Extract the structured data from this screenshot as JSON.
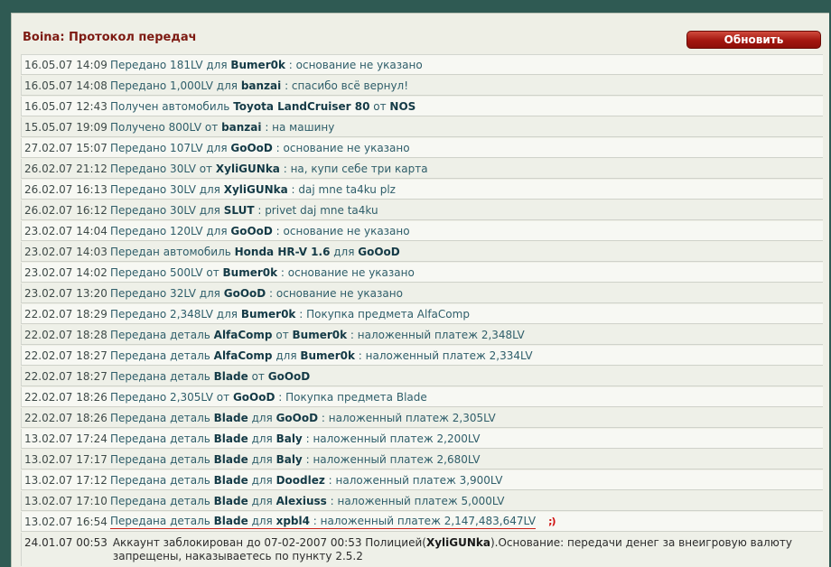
{
  "panel": {
    "title": "Boina: Протокол передач",
    "refresh_label": "Обновить"
  },
  "rows": [
    {
      "ts": "16.05.07 14:09",
      "pre": "Передано 181LV для ",
      "b1": "Bumer0k",
      "mid": " : основание не указано",
      "b2": "",
      "post": ""
    },
    {
      "ts": "16.05.07 14:08",
      "pre": "Передано 1,000LV для ",
      "b1": "banzai",
      "mid": " : спасибо всё вернул!",
      "b2": "",
      "post": ""
    },
    {
      "ts": "16.05.07 12:43",
      "pre": "Получен автомобиль ",
      "b1": "Toyota LandCruiser 80",
      "mid": " от ",
      "b2": "NOS",
      "post": ""
    },
    {
      "ts": "15.05.07 19:09",
      "pre": "Получено 800LV от ",
      "b1": "banzai",
      "mid": " : на машину",
      "b2": "",
      "post": ""
    },
    {
      "ts": "27.02.07 15:07",
      "pre": "Передано 107LV для ",
      "b1": "GoOoD",
      "mid": " : основание не указано",
      "b2": "",
      "post": ""
    },
    {
      "ts": "26.02.07 21:12",
      "pre": "Передано 30LV от ",
      "b1": "XyliGUNka",
      "mid": " : на, купи себе три карта",
      "b2": "",
      "post": ""
    },
    {
      "ts": "26.02.07 16:13",
      "pre": "Передано 30LV для ",
      "b1": "XyliGUNka",
      "mid": " : daj mne ta4ku plz",
      "b2": "",
      "post": ""
    },
    {
      "ts": "26.02.07 16:12",
      "pre": "Передано 30LV для ",
      "b1": "SLUT",
      "mid": " : privet daj mne ta4ku",
      "b2": "",
      "post": ""
    },
    {
      "ts": "23.02.07 14:04",
      "pre": "Передано 120LV для ",
      "b1": "GoOoD",
      "mid": " : основание не указано",
      "b2": "",
      "post": ""
    },
    {
      "ts": "23.02.07 14:03",
      "pre": "Передан автомобиль ",
      "b1": "Honda HR-V 1.6",
      "mid": " для ",
      "b2": "GoOoD",
      "post": ""
    },
    {
      "ts": "23.02.07 14:02",
      "pre": "Передано 500LV от ",
      "b1": "Bumer0k",
      "mid": " : основание не указано",
      "b2": "",
      "post": ""
    },
    {
      "ts": "23.02.07 13:20",
      "pre": "Передано 32LV для ",
      "b1": "GoOoD",
      "mid": " : основание не указано",
      "b2": "",
      "post": ""
    },
    {
      "ts": "22.02.07 18:29",
      "pre": "Передано 2,348LV для ",
      "b1": "Bumer0k",
      "mid": " : Покупка предмета AlfaComp",
      "b2": "",
      "post": ""
    },
    {
      "ts": "22.02.07 18:28",
      "pre": "Передана деталь ",
      "b1": "AlfaComp",
      "mid": " от ",
      "b2": "Bumer0k",
      "post": " : наложенный платеж 2,348LV"
    },
    {
      "ts": "22.02.07 18:27",
      "pre": "Передана деталь ",
      "b1": "AlfaComp",
      "mid": " для ",
      "b2": "Bumer0k",
      "post": " : наложенный платеж 2,334LV"
    },
    {
      "ts": "22.02.07 18:27",
      "pre": "Передана деталь ",
      "b1": "Blade",
      "mid": " от ",
      "b2": "GoOoD",
      "post": ""
    },
    {
      "ts": "22.02.07 18:26",
      "pre": "Передано 2,305LV от ",
      "b1": "GoOoD",
      "mid": " : Покупка предмета Blade",
      "b2": "",
      "post": ""
    },
    {
      "ts": "22.02.07 18:26",
      "pre": "Передана деталь ",
      "b1": "Blade",
      "mid": " для ",
      "b2": "GoOoD",
      "post": " : наложенный платеж 2,305LV"
    },
    {
      "ts": "13.02.07 17:24",
      "pre": "Передана деталь ",
      "b1": "Blade",
      "mid": " для ",
      "b2": "Baly",
      "post": " : наложенный платеж 2,200LV"
    },
    {
      "ts": "13.02.07 17:17",
      "pre": "Передана деталь ",
      "b1": "Blade",
      "mid": " для ",
      "b2": "Baly",
      "post": " : наложенный платеж 2,680LV"
    },
    {
      "ts": "13.02.07 17:12",
      "pre": "Передана деталь ",
      "b1": "Blade",
      "mid": " для ",
      "b2": "Doodlez",
      "post": " : наложенный платеж 3,900LV"
    },
    {
      "ts": "13.02.07 17:10",
      "pre": "Передана деталь ",
      "b1": "Blade",
      "mid": " для ",
      "b2": "Alexiuss",
      "post": " : наложенный платеж 5,000LV"
    },
    {
      "ts": "13.02.07 16:54",
      "pre": "Передана деталь ",
      "b1": "Blade",
      "mid": " для ",
      "b2": "xpbl4",
      "post": " : наложенный платеж 2,147,483,647LV"
    }
  ],
  "wink": ";)",
  "last": {
    "ts": "24.01.07 00:53",
    "pre": "Аккаунт заблокирован до 07-02-2007 00:53 Полицией(",
    "b1": "XyliGUNka",
    "post": ").Основание: передачи денег за внеигровую валюту запрещены, наказываетесь по пункту 2.5.2"
  },
  "colors": {
    "accent": "#7d1a12",
    "button": "#a3160f",
    "background": "#2f5a53"
  }
}
